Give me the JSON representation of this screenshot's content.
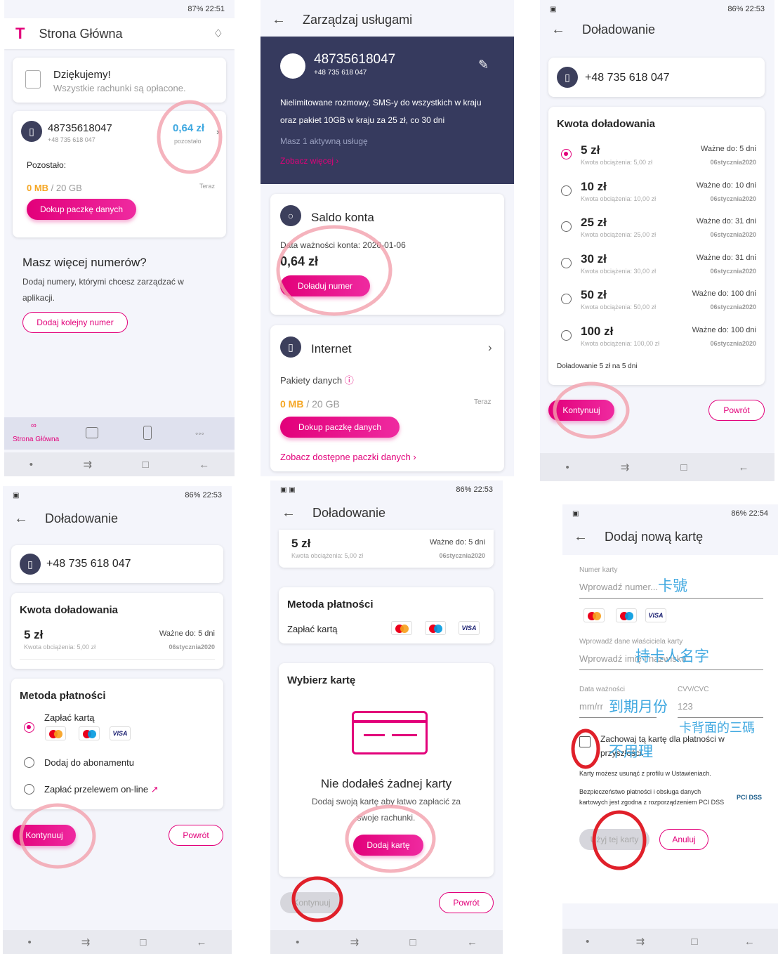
{
  "screens": {
    "home": {
      "status": "87% 22:51",
      "title": "Strona Główna",
      "thanks_title": "Dziękujemy!",
      "thanks_sub": "Wszystkie rachunki są opłacone.",
      "number": "48735618047",
      "number_formatted": "+48 735 618 047",
      "balance": "0,64 zł",
      "balance_label": "pozostało",
      "remaining_label": "Pozostało:",
      "data_used": "0 MB",
      "data_total": " / 20 GB",
      "data_time": "Teraz",
      "buy_data_button": "Dokup paczkę danych",
      "more_numbers_title": "Masz więcej numerów?",
      "more_numbers_text": "Dodaj numery, którymi chcesz zarządzać w aplikacji.",
      "add_number_button": "Dodaj kolejny numer",
      "nav_home": "Strona Główna"
    },
    "manage": {
      "title": "Zarządzaj usługami",
      "number": "48735618047",
      "number_formatted": "+48 735 618 047",
      "plan_desc": "Nielimitowane rozmowy, SMS-y do wszystkich w kraju oraz pakiet 10GB w kraju za 25 zł, co 30 dni",
      "active_services": "Masz 1 aktywną usługę",
      "see_more": "Zobacz więcej",
      "saldo_title": "Saldo konta",
      "validity": "Data ważności konta: 2020-01-06",
      "balance": "0,64 zł",
      "topup_button": "Doładuj numer",
      "internet_title": "Internet",
      "packages_label": "Pakiety danych",
      "data_used": "0 MB",
      "data_total": " / 20 GB",
      "data_time": "Teraz",
      "buy_data_button": "Dokup paczkę danych",
      "see_packages": "Zobacz dostępne paczki danych"
    },
    "topup": {
      "status": "86% 22:53",
      "title": "Doładowanie",
      "number": "+48 735 618 047",
      "amount_header": "Kwota doładowania",
      "options": [
        {
          "amount": "5 zł",
          "charge": "Kwota obciążenia: 5,00 zł",
          "valid": "Ważne do: 5 dni",
          "code": "06stycznia2020"
        },
        {
          "amount": "10 zł",
          "charge": "Kwota obciążenia: 10,00 zł",
          "valid": "Ważne do: 10 dni",
          "code": "06stycznia2020"
        },
        {
          "amount": "25 zł",
          "charge": "Kwota obciążenia: 25,00 zł",
          "valid": "Ważne do: 31 dni",
          "code": "06stycznia2020"
        },
        {
          "amount": "30 zł",
          "charge": "Kwota obciążenia: 30,00 zł",
          "valid": "Ważne do: 31 dni",
          "code": "06stycznia2020"
        },
        {
          "amount": "50 zł",
          "charge": "Kwota obciążenia: 50,00 zł",
          "valid": "Ważne do: 100 dni",
          "code": "06stycznia2020"
        },
        {
          "amount": "100 zł",
          "charge": "Kwota obciążenia: 100,00 zł",
          "valid": "Ważne do: 100 dni",
          "code": "06stycznia2020"
        }
      ],
      "summary": "Doładowanie 5 zł na 5 dni",
      "continue_button": "Kontynuuj",
      "back_button": "Powrót"
    },
    "payment": {
      "status": "86% 22:53",
      "title": "Doładowanie",
      "number": "+48 735 618 047",
      "amount_header": "Kwota doładowania",
      "amount": "5 zł",
      "charge": "Kwota obciążenia: 5,00 zł",
      "valid": "Ważne do: 5 dni",
      "code": "06stycznia2020",
      "method_header": "Metoda płatności",
      "opt_card": "Zapłać kartą",
      "opt_subscription": "Dodaj do abonamentu",
      "opt_transfer": "Zapłać przelewem on-line",
      "continue_button": "Kontynuuj",
      "back_button": "Powrót"
    },
    "card_select": {
      "status": "86% 22:53",
      "title": "Doładowanie",
      "amount": "5 zł",
      "charge": "Kwota obciążenia: 5,00 zł",
      "valid": "Ważne do: 5 dni",
      "code": "06stycznia2020",
      "method_header": "Metoda płatności",
      "pay_card": "Zapłać kartą",
      "choose_card": "Wybierz kartę",
      "no_card_title": "Nie dodałeś żadnej karty",
      "no_card_text": "Dodaj swoją kartę aby łatwo zapłacić za swoje rachunki.",
      "add_card_button": "Dodaj kartę",
      "continue_button": "Kontynuuj",
      "back_button": "Powrót"
    },
    "new_card": {
      "status": "86% 22:54",
      "title": "Dodaj nową kartę",
      "card_number_label": "Numer karty",
      "card_number_placeholder": "Wprowadź numer...",
      "owner_label": "Wprowadź dane właściciela karty",
      "owner_placeholder": "Wprowadź imię i nazwisko",
      "expiry_label": "Data ważności",
      "expiry_placeholder": "mm/rr",
      "cvv_label": "CVV/CVC",
      "cvv_placeholder": "123",
      "save_card": "Zachowaj tą kartę dla płatności w przyszłości.",
      "remove_note": "Karty możesz usunąć z profilu w Ustawieniach.",
      "security_note": "Bezpieczeństwo płatności i obsługa danych kartowych jest zgodna z rozporządzeniem PCI DSS",
      "use_card_button": "Użyj tej karty",
      "cancel_button": "Anuluj",
      "hw1": "卡號",
      "hw2": "持卡人名字",
      "hw3": "到期月份",
      "hw4": "卡背面的三碼",
      "hw5": "不用理"
    }
  }
}
